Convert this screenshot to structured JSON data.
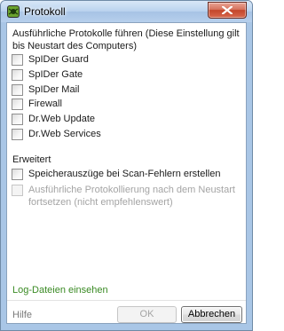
{
  "window": {
    "title": "Protokoll",
    "close_icon": "close-x-icon",
    "app_icon": "drweb-spider-icon"
  },
  "intro_text": "Ausführliche Protokolle führen (Diese Einstellung gilt bis Neustart des Computers)",
  "components": [
    {
      "label": "SpIDer Guard",
      "checked": false,
      "enabled": true
    },
    {
      "label": "SpIDer Gate",
      "checked": false,
      "enabled": true
    },
    {
      "label": "SpIDer Mail",
      "checked": false,
      "enabled": true
    },
    {
      "label": "Firewall",
      "checked": false,
      "enabled": true
    },
    {
      "label": "Dr.Web Update",
      "checked": false,
      "enabled": true
    },
    {
      "label": "Dr.Web Services",
      "checked": false,
      "enabled": true
    }
  ],
  "advanced": {
    "title": "Erweitert",
    "options": [
      {
        "label": "Speicherauszüge bei Scan-Fehlern erstellen",
        "checked": false,
        "enabled": true
      },
      {
        "label": "Ausführliche Protokollierung nach dem Neustart fortsetzen (nicht empfehlenswert)",
        "checked": false,
        "enabled": false
      }
    ]
  },
  "link_text": "Log-Dateien einsehen",
  "footer": {
    "help": "Hilfe",
    "ok": "OK",
    "cancel": "Abbrechen"
  },
  "colors": {
    "link": "#3a8a24",
    "disabled_text": "#a4a4a4",
    "titlebar": "#b9d2ee"
  }
}
